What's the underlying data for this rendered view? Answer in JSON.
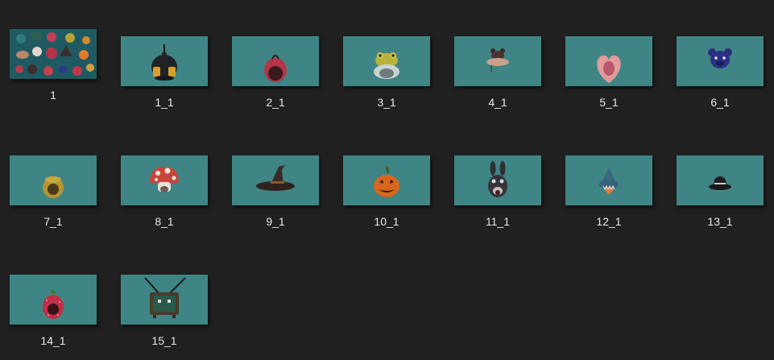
{
  "window": {
    "background": "#202020",
    "thumbnail_background": "#3f8585"
  },
  "files": [
    {
      "name": "1",
      "icon": "collage-thumbnail"
    },
    {
      "name": "1_1",
      "icon": "bomb-helmet"
    },
    {
      "name": "2_1",
      "icon": "red-hood"
    },
    {
      "name": "3_1",
      "icon": "frog-hat"
    },
    {
      "name": "4_1",
      "icon": "bear-cap"
    },
    {
      "name": "5_1",
      "icon": "heart-mouth"
    },
    {
      "name": "6_1",
      "icon": "blue-bear-head"
    },
    {
      "name": "7_1",
      "icon": "yellow-helmet"
    },
    {
      "name": "8_1",
      "icon": "mushroom-hat"
    },
    {
      "name": "9_1",
      "icon": "witch-hat"
    },
    {
      "name": "10_1",
      "icon": "pumpkin-head"
    },
    {
      "name": "11_1",
      "icon": "bunny-head"
    },
    {
      "name": "12_1",
      "icon": "shark-hood"
    },
    {
      "name": "13_1",
      "icon": "black-bowler-hat"
    },
    {
      "name": "14_1",
      "icon": "strawberry-head"
    },
    {
      "name": "15_1",
      "icon": "tv-head"
    }
  ]
}
